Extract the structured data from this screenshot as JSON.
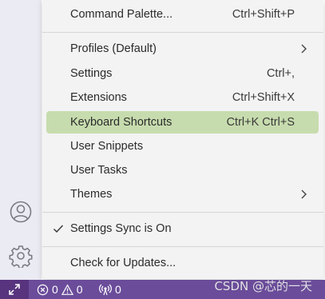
{
  "menu": {
    "items": [
      {
        "label": "Command Palette...",
        "shortcut": "Ctrl+Shift+P"
      },
      {
        "label": "Profiles (Default)",
        "shortcut": ""
      },
      {
        "label": "Settings",
        "shortcut": "Ctrl+,"
      },
      {
        "label": "Extensions",
        "shortcut": "Ctrl+Shift+X"
      },
      {
        "label": "Keyboard Shortcuts",
        "shortcut": "Ctrl+K Ctrl+S"
      },
      {
        "label": "User Snippets",
        "shortcut": ""
      },
      {
        "label": "User Tasks",
        "shortcut": ""
      },
      {
        "label": "Themes",
        "shortcut": ""
      },
      {
        "label": "Settings Sync is On",
        "shortcut": ""
      },
      {
        "label": "Check for Updates...",
        "shortcut": ""
      }
    ],
    "highlight_color": "#c7dcae"
  },
  "activity_bar": {
    "icons": [
      "account-icon",
      "manage-gear-icon"
    ]
  },
  "status_bar": {
    "background": "#6b4c9a",
    "errors": "0",
    "warnings": "0",
    "ports": "0"
  },
  "watermark": "CSDN @芯的一天"
}
